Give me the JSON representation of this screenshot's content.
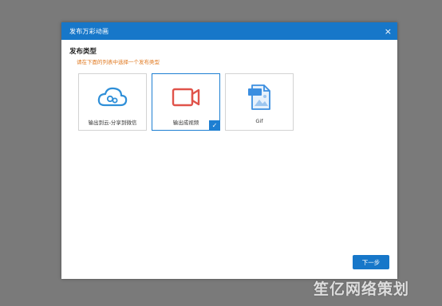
{
  "dialog": {
    "title": "发布万彩动画",
    "close_label": "×"
  },
  "section": {
    "heading": "发布类型",
    "hint": "请在下面的列表中选择一个发布类型"
  },
  "options": [
    {
      "label": "输出到云-分享到微信",
      "icon": "cloud-share-icon",
      "selected": false
    },
    {
      "label": "输出成视频",
      "icon": "video-camera-icon",
      "selected": true
    },
    {
      "label": "Gif",
      "icon": "gif-file-icon",
      "selected": false
    }
  ],
  "check_glyph": "✓",
  "next_button": {
    "label": "下一步"
  },
  "watermark": {
    "text": "笙亿网络策划"
  },
  "colors": {
    "accent": "#1777c9",
    "hint": "#e0781f",
    "cloud_icon": "#2f8fd8",
    "video_icon": "#e0534a",
    "gif_icon": "#3b8ee0"
  }
}
